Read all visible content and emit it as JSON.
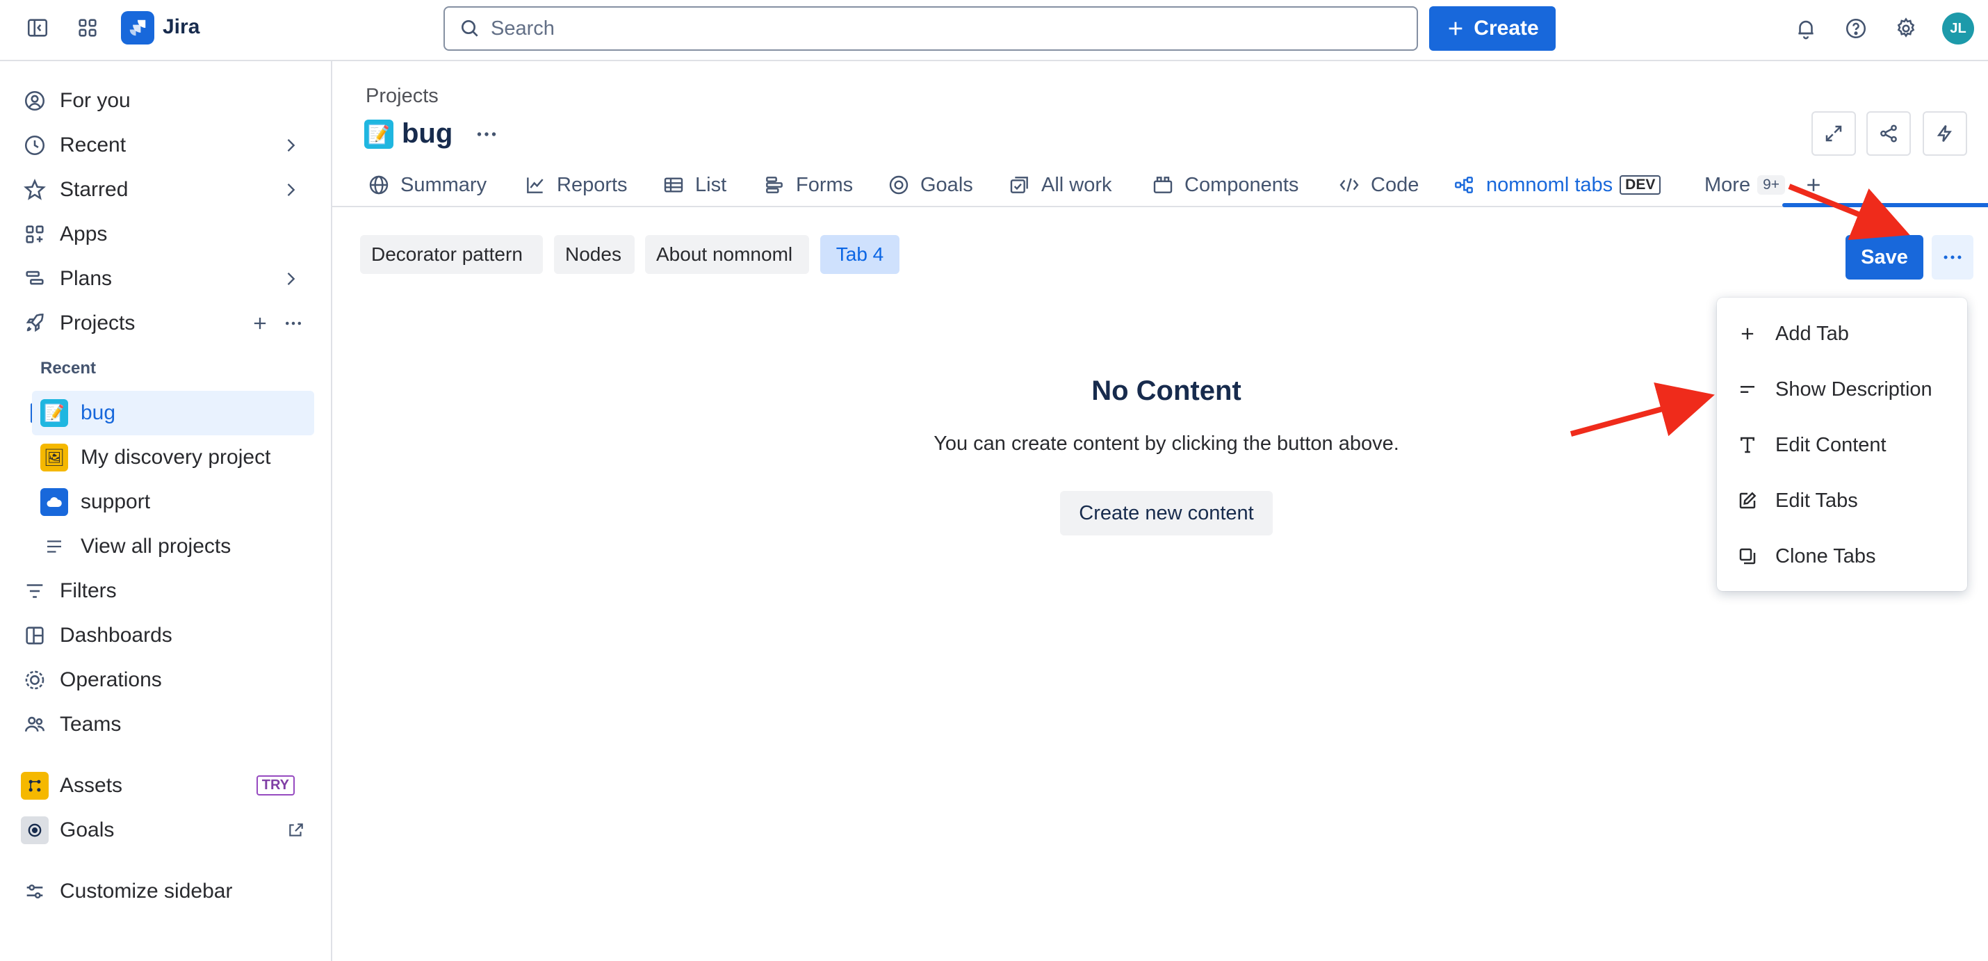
{
  "app": {
    "name": "Jira",
    "search_placeholder": "Search",
    "create_label": "Create",
    "avatar_initials": "JL"
  },
  "sidebar": {
    "items": [
      {
        "label": "For you"
      },
      {
        "label": "Recent"
      },
      {
        "label": "Starred"
      },
      {
        "label": "Apps"
      },
      {
        "label": "Plans"
      },
      {
        "label": "Projects"
      }
    ],
    "recent_label": "Recent",
    "projects": [
      {
        "label": "bug"
      },
      {
        "label": "My discovery project"
      },
      {
        "label": "support"
      },
      {
        "label": "View all projects"
      }
    ],
    "items2": [
      {
        "label": "Filters"
      },
      {
        "label": "Dashboards"
      },
      {
        "label": "Operations"
      },
      {
        "label": "Teams"
      }
    ],
    "assets_label": "Assets",
    "try_badge": "TRY",
    "goals_label": "Goals",
    "customize_label": "Customize sidebar"
  },
  "header": {
    "breadcrumb": "Projects",
    "title": "bug"
  },
  "tabs": [
    {
      "label": "Summary"
    },
    {
      "label": "Reports"
    },
    {
      "label": "List"
    },
    {
      "label": "Forms"
    },
    {
      "label": "Goals"
    },
    {
      "label": "All work"
    },
    {
      "label": "Components"
    },
    {
      "label": "Code"
    },
    {
      "label": "nomnoml tabs",
      "badge": "DEV"
    },
    {
      "label": "More",
      "badge": "9+"
    }
  ],
  "content_tabs": [
    {
      "label": "Decorator pattern"
    },
    {
      "label": "Nodes"
    },
    {
      "label": "About nomnoml"
    },
    {
      "label": "Tab 4"
    }
  ],
  "toolbar": {
    "save_label": "Save"
  },
  "empty_state": {
    "title": "No Content",
    "description": "You can create content by clicking the button above.",
    "button_label": "Create new content"
  },
  "menu": {
    "items": [
      {
        "label": "Add Tab",
        "icon": "plus-icon"
      },
      {
        "label": "Show Description",
        "icon": "description-icon"
      },
      {
        "label": "Edit Content",
        "icon": "text-icon"
      },
      {
        "label": "Edit Tabs",
        "icon": "edit-icon"
      },
      {
        "label": "Clone Tabs",
        "icon": "clone-icon"
      }
    ]
  },
  "colors": {
    "brand": "#1868db",
    "annotation_arrow": "#ef2b1b"
  }
}
